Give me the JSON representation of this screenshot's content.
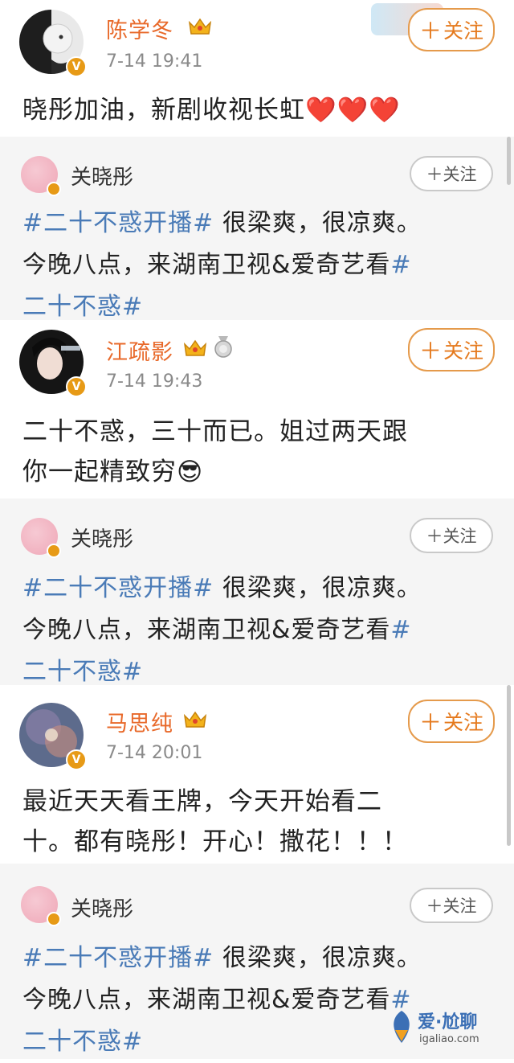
{
  "posts": [
    {
      "name": "陈学冬",
      "time": "7-14 19:41",
      "follow_label": "关注",
      "text": "晓彤加油，新剧收视长虹",
      "emoji": "❤️❤️❤️"
    },
    {
      "name": "江疏影",
      "time": "7-14 19:43",
      "follow_label": "关注",
      "text_line1": "二十不惑，三十而已。姐过两天跟",
      "text_line2": "你一起精致穷",
      "emoji": "😎"
    },
    {
      "name": "马思纯",
      "time": "7-14 20:01",
      "follow_label": "关注",
      "text_line1": "最近天天看王牌，今天开始看二",
      "text_line2": "十。都有晓彤！开心！撒花！！！"
    }
  ],
  "repost": {
    "name": "关晓彤",
    "follow_label": "关注",
    "tag_start": "#二十不惑开播#",
    "line1_rest": " 很梁爽，很凉爽。",
    "line2_text": "今晚八点，来湖南卫视&爱奇艺看",
    "line2_tag": "#",
    "line3_tag": "二十不惑#"
  },
  "watermark": {
    "text": "爱·尬聊",
    "url": "igaliao.com"
  },
  "colors": {
    "name_orange": "#e8692a",
    "follow_orange": "#e59a4b",
    "tag_blue": "#4a7bb7",
    "repost_bg": "#f5f5f5",
    "verified_badge": "#e79a16"
  }
}
